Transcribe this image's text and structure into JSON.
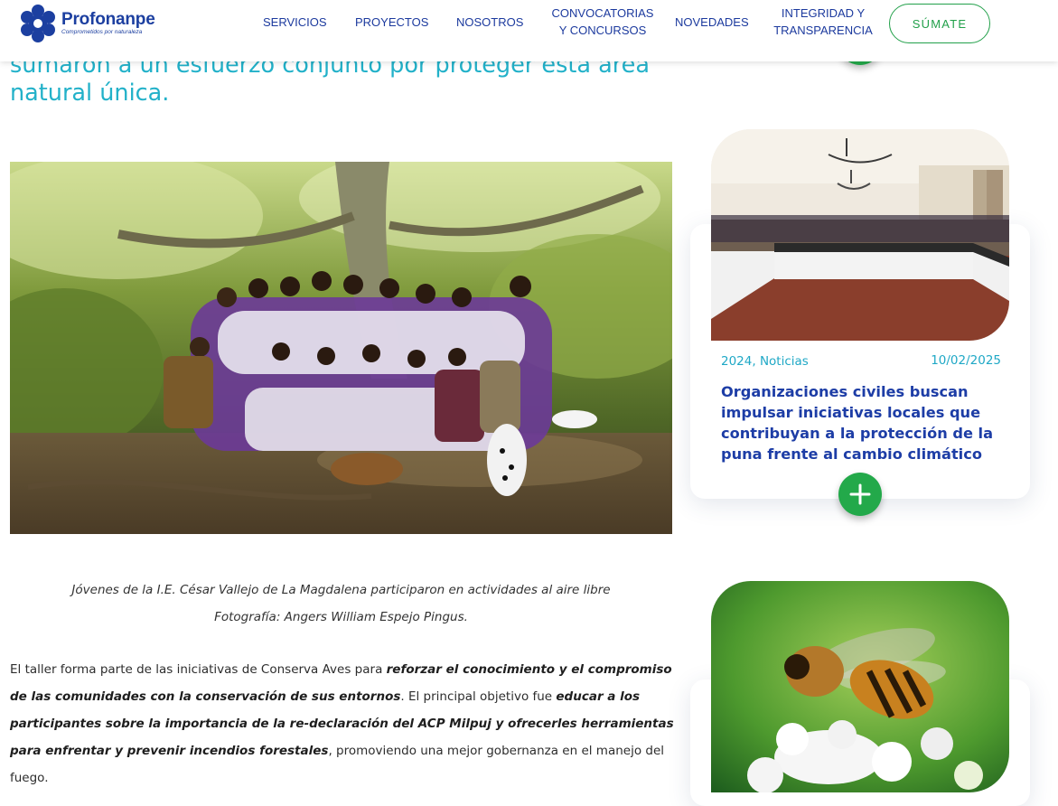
{
  "header": {
    "logo": {
      "name": "Profonanpe",
      "tagline": "Comprometidos por naturaleza"
    },
    "nav": [
      {
        "label": "SERVICIOS"
      },
      {
        "label": "PROYECTOS"
      },
      {
        "label": "NOSOTROS"
      },
      {
        "label_line1": "CONVOCATORIAS",
        "label_line2": "Y CONCURSOS"
      },
      {
        "label": "NOVEDADES"
      },
      {
        "label_line1": "INTEGRIDAD Y",
        "label_line2": "TRANSPARENCIA"
      }
    ],
    "cta_label": "SÚMATE"
  },
  "article": {
    "lead_line1": "sumaron a un esfuerzo conjunto por proteger esta área",
    "lead_line2": "natural única.",
    "photo_caption": "Jóvenes de la I.E. César Vallejo de La Magdalena participaron en actividades al aire libre",
    "photo_credit": "Fotografía: Angers William Espejo Pingus.",
    "paragraph": {
      "part1": "El taller forma parte de las iniciativas de Conserva Aves para ",
      "bold1": "reforzar el conocimiento y el compromiso de las comunidades con la conservación de sus entornos",
      "part2": ". El principal objetivo fue ",
      "bold2": "educar a los participantes sobre la importancia de la re-declaración del ACP Milpuj y ofrecerles herramientas para enfrentar y prevenir incendios forestales",
      "part3": ", promoviendo una mejor gobernanza en el manejo del fuego."
    }
  },
  "sidebar": {
    "cards": [
      {
        "category": "2024, Noticias",
        "date": "10/02/2025",
        "title": "Organizaciones civiles buscan impulsar iniciativas locales que contribuyan a la protección de la puna frente al cambio climático"
      }
    ]
  },
  "colors": {
    "brand_blue": "#1c3fa0",
    "accent_cyan": "#22b1c9",
    "accent_green": "#23a94a"
  }
}
